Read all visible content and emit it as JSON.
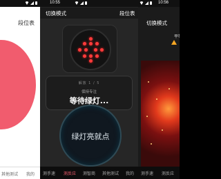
{
  "left": {
    "title": "段位表",
    "nav": [
      "其他测试",
      "我的"
    ]
  },
  "middle": {
    "status_time": "10:55",
    "mode_button": "切换模式",
    "title": "段位表",
    "round_label": "解放 1 / 5",
    "keep_label": "保持专注",
    "wait_label": "等待绿灯...",
    "tap_button": "绿灯亮就点",
    "nav": [
      "测手速",
      "测反应",
      "测智商",
      "其他测试",
      "我的"
    ]
  },
  "right": {
    "status_time": "10:56",
    "mode_button": "切换模式",
    "badge": "平等",
    "nav": [
      "测手速",
      "测反应"
    ]
  },
  "colors": {
    "left_circle": "#f15c6e",
    "signal_red": "#ff3b3b",
    "active_nav": "#f15c6e"
  }
}
